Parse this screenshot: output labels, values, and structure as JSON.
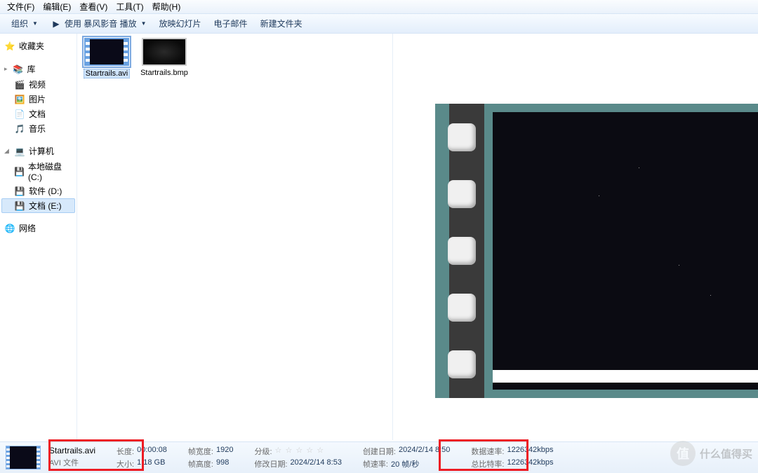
{
  "menu": {
    "file": "文件(F)",
    "edit": "编辑(E)",
    "view": "查看(V)",
    "tools": "工具(T)",
    "help": "帮助(H)"
  },
  "toolbar": {
    "organize": "组织",
    "play": "使用 暴风影音 播放",
    "slideshow": "放映幻灯片",
    "email": "电子邮件",
    "newfolder": "新建文件夹"
  },
  "sidebar": {
    "fav": {
      "label": "收藏夹"
    },
    "lib": {
      "label": "库",
      "video": "视频",
      "pics": "图片",
      "docs": "文档",
      "music": "音乐"
    },
    "comp": {
      "label": "计算机",
      "c": "本地磁盘 (C:)",
      "d": "软件 (D:)",
      "e": "文档 (E:)"
    },
    "net": {
      "label": "网络"
    }
  },
  "files": {
    "f1": "Startrails.avi",
    "f2": "Startrails.bmp"
  },
  "details": {
    "name": "Startrails.avi",
    "type": "AVI 文件",
    "len_l": "长度:",
    "len_v": "00:00:08",
    "size_l": "大小:",
    "size_v": "1.18 GB",
    "fw_l": "帧宽度:",
    "fw_v": "1920",
    "fh_l": "帧高度:",
    "fh_v": "998",
    "rate_l": "分级:",
    "mod_l": "修改日期:",
    "mod_v": "2024/2/14 8:53",
    "cre_l": "创建日期:",
    "cre_v": "2024/2/14 8:50",
    "fps_l": "帧速率:",
    "fps_v": "20 帧/秒",
    "dr_l": "数据速率:",
    "dr_v": "1226342kbps",
    "tb_l": "总比特率:",
    "tb_v": "1226342kbps"
  },
  "watermark": {
    "badge": "值",
    "text": "什么值得买"
  }
}
